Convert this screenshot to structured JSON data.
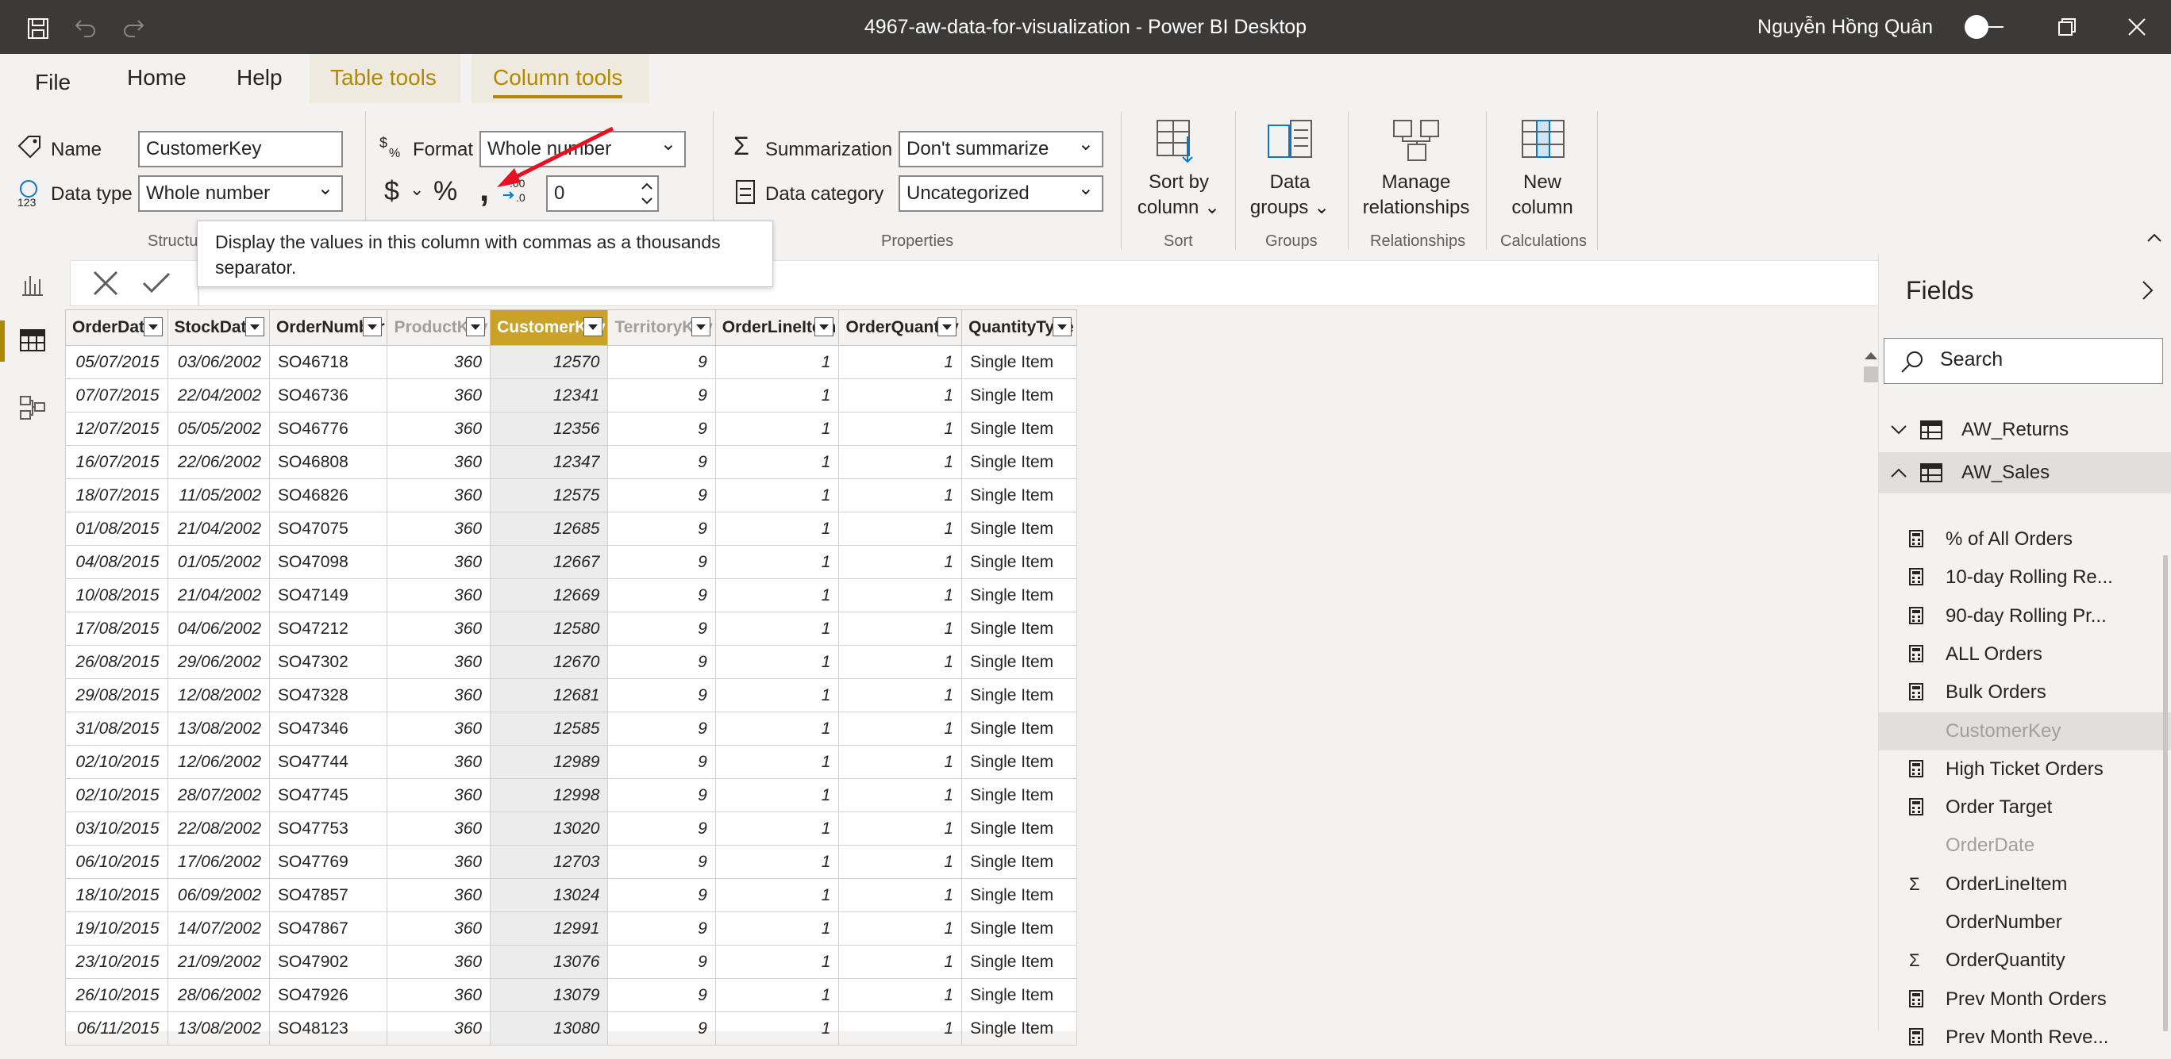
{
  "window": {
    "title": "4967-aw-data-for-visualization - Power BI Desktop",
    "user": "Nguyễn Hồng Quân"
  },
  "tabs": [
    {
      "label": "File"
    },
    {
      "label": "Home"
    },
    {
      "label": "Help"
    },
    {
      "label": "Table tools"
    },
    {
      "label": "Column tools"
    }
  ],
  "structure": {
    "name_label": "Name",
    "name_value": "CustomerKey",
    "datatype_label": "Data type",
    "datatype_value": "Whole number",
    "group_label": "Structu"
  },
  "formatting": {
    "format_label": "Format",
    "format_value": "Whole number",
    "decimal_value": "0"
  },
  "properties": {
    "summarization_label": "Summarization",
    "summarization_value": "Don't summarize",
    "category_label": "Data category",
    "category_value": "Uncategorized",
    "group_label": "Properties"
  },
  "sort": {
    "button_line1": "Sort by",
    "button_line2": "column",
    "group_label": "Sort"
  },
  "groups": {
    "button_line1": "Data",
    "button_line2": "groups",
    "group_label": "Groups"
  },
  "relationships": {
    "button_line1": "Manage",
    "button_line2": "relationships",
    "group_label": "Relationships"
  },
  "calculations": {
    "button_line1": "New",
    "button_line2": "column",
    "group_label": "Calculations"
  },
  "tooltip": {
    "text": "Display the values in this column with commas as a thousands separator."
  },
  "grid": {
    "columns": [
      "OrderDate",
      "StockDate",
      "OrderNumber",
      "ProductKey",
      "CustomerKey",
      "TerritoryKey",
      "OrderLineItem",
      "OrderQuantity",
      "QuantityType"
    ],
    "rows": [
      [
        "05/07/2015",
        "03/06/2002",
        "SO46718",
        "360",
        "12570",
        "9",
        "1",
        "1",
        "Single Item"
      ],
      [
        "07/07/2015",
        "22/04/2002",
        "SO46736",
        "360",
        "12341",
        "9",
        "1",
        "1",
        "Single Item"
      ],
      [
        "12/07/2015",
        "05/05/2002",
        "SO46776",
        "360",
        "12356",
        "9",
        "1",
        "1",
        "Single Item"
      ],
      [
        "16/07/2015",
        "22/06/2002",
        "SO46808",
        "360",
        "12347",
        "9",
        "1",
        "1",
        "Single Item"
      ],
      [
        "18/07/2015",
        "11/05/2002",
        "SO46826",
        "360",
        "12575",
        "9",
        "1",
        "1",
        "Single Item"
      ],
      [
        "01/08/2015",
        "21/04/2002",
        "SO47075",
        "360",
        "12685",
        "9",
        "1",
        "1",
        "Single Item"
      ],
      [
        "04/08/2015",
        "01/05/2002",
        "SO47098",
        "360",
        "12667",
        "9",
        "1",
        "1",
        "Single Item"
      ],
      [
        "10/08/2015",
        "21/04/2002",
        "SO47149",
        "360",
        "12669",
        "9",
        "1",
        "1",
        "Single Item"
      ],
      [
        "17/08/2015",
        "04/06/2002",
        "SO47212",
        "360",
        "12580",
        "9",
        "1",
        "1",
        "Single Item"
      ],
      [
        "26/08/2015",
        "29/06/2002",
        "SO47302",
        "360",
        "12670",
        "9",
        "1",
        "1",
        "Single Item"
      ],
      [
        "29/08/2015",
        "12/08/2002",
        "SO47328",
        "360",
        "12681",
        "9",
        "1",
        "1",
        "Single Item"
      ],
      [
        "31/08/2015",
        "13/08/2002",
        "SO47346",
        "360",
        "12585",
        "9",
        "1",
        "1",
        "Single Item"
      ],
      [
        "02/10/2015",
        "12/06/2002",
        "SO47744",
        "360",
        "12989",
        "9",
        "1",
        "1",
        "Single Item"
      ],
      [
        "02/10/2015",
        "28/07/2002",
        "SO47745",
        "360",
        "12998",
        "9",
        "1",
        "1",
        "Single Item"
      ],
      [
        "03/10/2015",
        "22/08/2002",
        "SO47753",
        "360",
        "13020",
        "9",
        "1",
        "1",
        "Single Item"
      ],
      [
        "06/10/2015",
        "17/06/2002",
        "SO47769",
        "360",
        "12703",
        "9",
        "1",
        "1",
        "Single Item"
      ],
      [
        "18/10/2015",
        "06/09/2002",
        "SO47857",
        "360",
        "13024",
        "9",
        "1",
        "1",
        "Single Item"
      ],
      [
        "19/10/2015",
        "14/07/2002",
        "SO47867",
        "360",
        "12991",
        "9",
        "1",
        "1",
        "Single Item"
      ],
      [
        "23/10/2015",
        "21/09/2002",
        "SO47902",
        "360",
        "13076",
        "9",
        "1",
        "1",
        "Single Item"
      ],
      [
        "26/10/2015",
        "28/06/2002",
        "SO47926",
        "360",
        "13079",
        "9",
        "1",
        "1",
        "Single Item"
      ],
      [
        "06/11/2015",
        "13/08/2002",
        "SO48123",
        "360",
        "13080",
        "9",
        "1",
        "1",
        "Single Item"
      ]
    ]
  },
  "fields": {
    "title": "Fields",
    "search_placeholder": "Search",
    "tables": [
      {
        "name": "AW_Returns"
      },
      {
        "name": "AW_Sales"
      }
    ],
    "items": [
      {
        "label": "% of All Orders",
        "icon": "calculator-icon"
      },
      {
        "label": "10-day Rolling Re...",
        "icon": "calculator-icon"
      },
      {
        "label": "90-day Rolling Pr...",
        "icon": "calculator-icon"
      },
      {
        "label": "ALL Orders",
        "icon": "calculator-icon"
      },
      {
        "label": "Bulk Orders",
        "icon": "calculator-icon"
      },
      {
        "label": "CustomerKey",
        "icon": ""
      },
      {
        "label": "High Ticket Orders",
        "icon": "calculator-icon"
      },
      {
        "label": "Order Target",
        "icon": "calculator-icon"
      },
      {
        "label": "OrderDate",
        "icon": ""
      },
      {
        "label": "OrderLineItem",
        "icon": "sigma-icon"
      },
      {
        "label": "OrderNumber",
        "icon": ""
      },
      {
        "label": "OrderQuantity",
        "icon": "sigma-icon"
      },
      {
        "label": "Prev Month Orders",
        "icon": "calculator-icon"
      },
      {
        "label": "Prev Month Reve...",
        "icon": "calculator-icon"
      }
    ]
  },
  "colors": {
    "accent": "#b08900",
    "titlebar": "#3b3a39",
    "selected_header": "#c9a227",
    "arrow": "#e81123"
  }
}
